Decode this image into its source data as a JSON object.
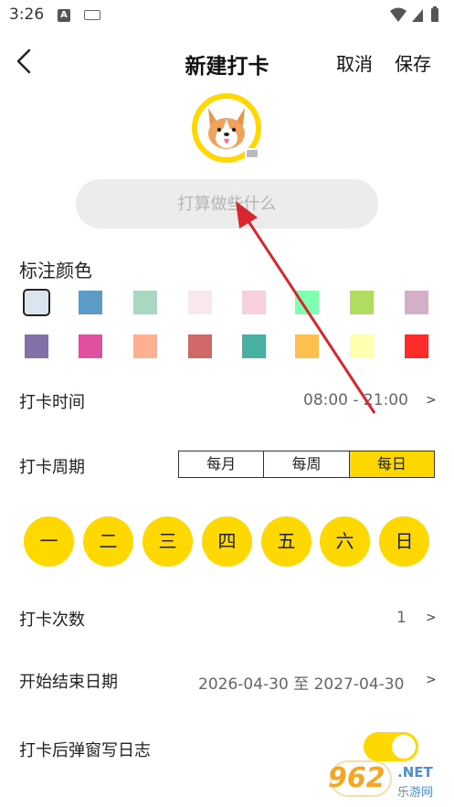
{
  "status_bar": {
    "time": "3:26",
    "a_icon_letter": "A"
  },
  "header": {
    "title": "新建打卡",
    "cancel_label": "取消",
    "save_label": "保存"
  },
  "name_input": {
    "placeholder": "打算做些什么",
    "value": ""
  },
  "color_section": {
    "label": "标注颜色",
    "colors": [
      "#d9e6f0",
      "#5b9bc8",
      "#a8d8c0",
      "#f8e8ee",
      "#f8d0dc",
      "#80ffb0",
      "#b0dc60",
      "#d4b0c8",
      "#8470a8",
      "#e050a0",
      "#ffb090",
      "#d06868",
      "#48b0a0",
      "#ffc050",
      "#ffffb0",
      "#ff2a2a"
    ],
    "selected_index": 0
  },
  "time_row": {
    "label": "打卡时间",
    "value": "08:00 - 21:00",
    "chevron": ">"
  },
  "period_row": {
    "label": "打卡周期",
    "options": [
      "每月",
      "每周",
      "每日"
    ],
    "active_index": 2
  },
  "days": [
    "一",
    "二",
    "三",
    "四",
    "五",
    "六",
    "日"
  ],
  "count_row": {
    "label": "打卡次数",
    "value": "1",
    "chevron": ">"
  },
  "date_row": {
    "label": "开始结束日期",
    "value": "2026-04-30 至 2027-04-30",
    "chevron": ">"
  },
  "popup_row": {
    "label": "打卡后弹窗写日志",
    "toggle_on": true
  },
  "watermark": {
    "number": "962",
    "net": ".NET",
    "sub": "乐游网"
  },
  "colors": {
    "accent": "#ffd800",
    "annotation_arrow": "#d9262c"
  }
}
